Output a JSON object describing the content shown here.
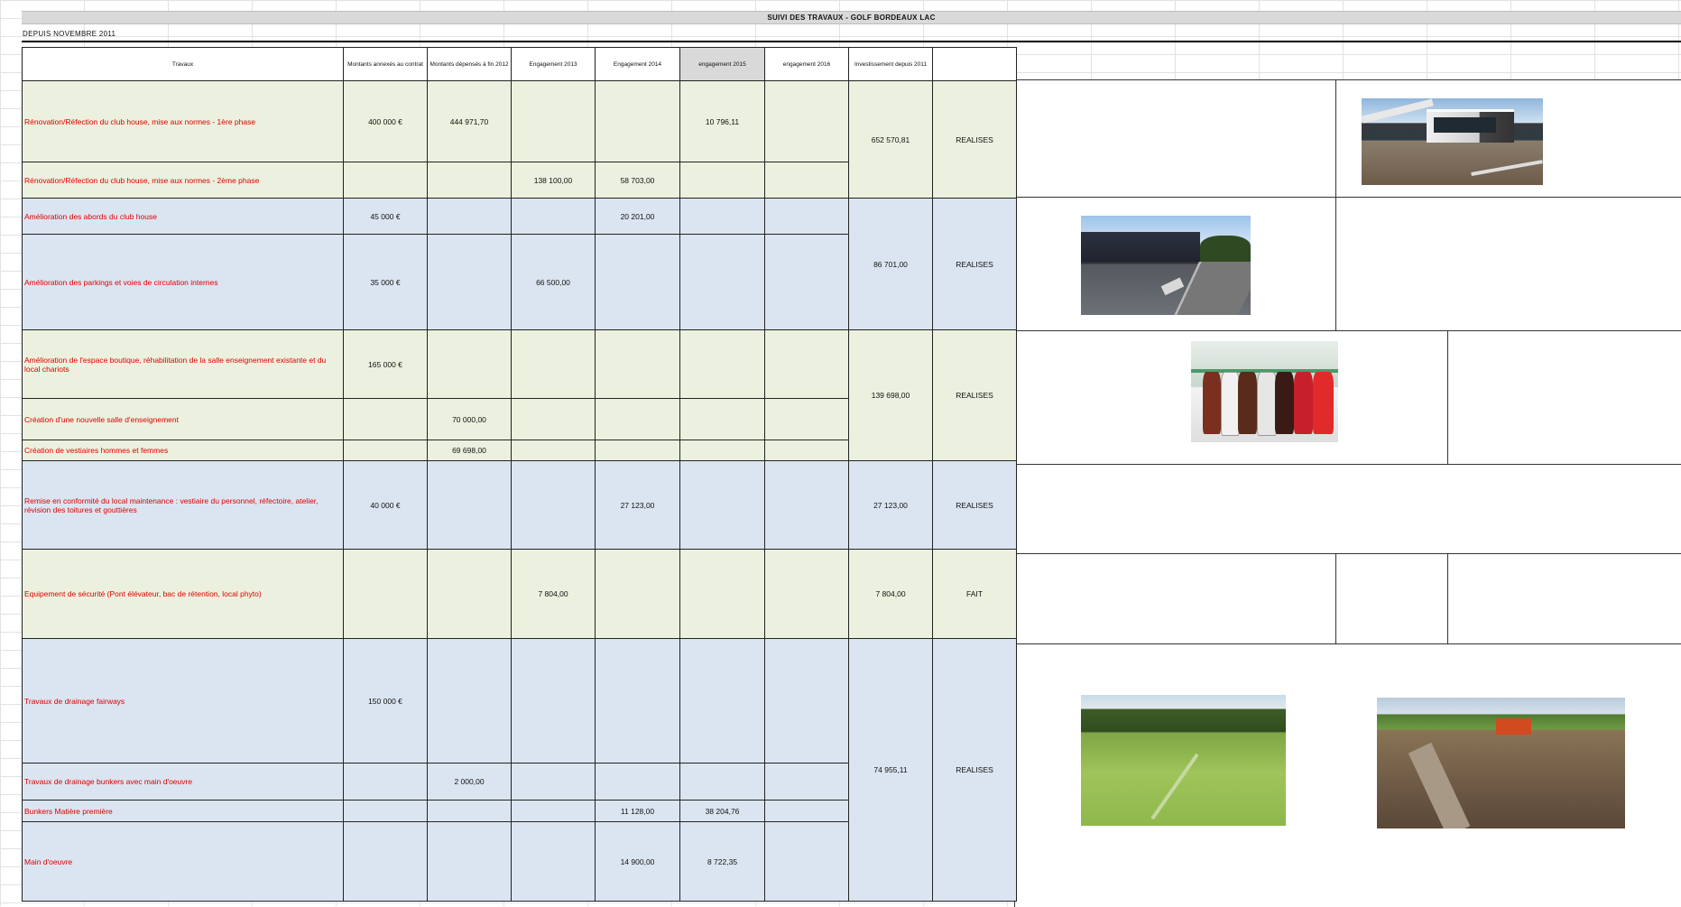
{
  "sheet": {
    "title": "SUIVI DES TRAVAUX - GOLF BORDEAUX LAC",
    "subtitle": "DEPUIS NOVEMBRE 2011"
  },
  "headers": {
    "travaux": "Travaux",
    "montants": "Montants annexés au contrat",
    "depenses": "Montants dépensés à fin 2012",
    "eng2013": "Engagement 2013",
    "eng2014": "Engagement 2014",
    "eng2015": "engagement 2015",
    "eng2016": "engagement 2016",
    "invest": "Investissement depuis 2011"
  },
  "groups": [
    {
      "color": "green",
      "investment": "652 570,81",
      "status": "REALISES",
      "rows": [
        {
          "label": "Rénovation/Réfection du club house, mise aux normes - 1ère phase",
          "montant": "400 000 €",
          "depenses": "444 971,70",
          "eng2013": "",
          "eng2014": "",
          "eng2015": "10 796,11",
          "eng2016": ""
        },
        {
          "label": "Rénovation/Réfection du club house, mise aux normes - 2ème phase",
          "montant": "",
          "depenses": "",
          "eng2013": "138 100,00",
          "eng2014": "58 703,00",
          "eng2015": "",
          "eng2016": ""
        }
      ]
    },
    {
      "color": "blue",
      "investment": "86 701,00",
      "status": "REALISES",
      "rows": [
        {
          "label": "Amélioration des abords du club house",
          "montant": "45 000 €",
          "depenses": "",
          "eng2013": "",
          "eng2014": "20 201,00",
          "eng2015": "",
          "eng2016": ""
        },
        {
          "label": "Amélioration des parkings et voies de circulation internes",
          "montant": "35 000 €",
          "depenses": "",
          "eng2013": "66 500,00",
          "eng2014": "",
          "eng2015": "",
          "eng2016": ""
        }
      ]
    },
    {
      "color": "green",
      "investment": "139 698,00",
      "status": "REALISES",
      "rows": [
        {
          "label": "Amélioration de l'espace boutique, réhabilitation de la salle enseignement existante et du local chariots",
          "montant": "165 000 €",
          "depenses": "",
          "eng2013": "",
          "eng2014": "",
          "eng2015": "",
          "eng2016": ""
        },
        {
          "label": "Création d'une nouvelle salle d'enseignement",
          "montant": "",
          "depenses": "70 000,00",
          "eng2013": "",
          "eng2014": "",
          "eng2015": "",
          "eng2016": ""
        },
        {
          "label": "Création de vestiaires hommes et femmes",
          "montant": "",
          "depenses": "69 698,00",
          "eng2013": "",
          "eng2014": "",
          "eng2015": "",
          "eng2016": ""
        }
      ]
    },
    {
      "color": "blue",
      "investment": "27 123,00",
      "status": "REALISES",
      "rows": [
        {
          "label": "Remise en conformité du local maintenance : vestiaire du personnel, réfectoire, atelier, révision des toitures et gouttières",
          "montant": "40 000 €",
          "depenses": "",
          "eng2013": "",
          "eng2014": "27 123,00",
          "eng2015": "",
          "eng2016": ""
        }
      ]
    },
    {
      "color": "green",
      "investment": "7 804,00",
      "status": "FAIT",
      "rows": [
        {
          "label": "Equipement de sécurité (Pont élévateur, bac de rétention, local phyto)",
          "montant": "",
          "depenses": "",
          "eng2013": "7 804,00",
          "eng2014": "",
          "eng2015": "",
          "eng2016": ""
        }
      ]
    },
    {
      "color": "blue",
      "investment": "74 955,11",
      "status": "REALISES",
      "rows": [
        {
          "label": "Travaux de drainage fairways",
          "montant": "150 000 €",
          "depenses": "",
          "eng2013": "",
          "eng2014": "",
          "eng2015": "",
          "eng2016": ""
        },
        {
          "label": "Travaux de drainage bunkers avec main d'oeuvre",
          "montant": "",
          "depenses": "2 000,00",
          "eng2013": "",
          "eng2014": "",
          "eng2015": "",
          "eng2016": ""
        },
        {
          "label": "Bunkers Matière première",
          "montant": "",
          "depenses": "",
          "eng2013": "",
          "eng2014": "11 128,00",
          "eng2015": "38 204,76",
          "eng2016": ""
        },
        {
          "label": "Main d'oeuvre",
          "montant": "",
          "depenses": "",
          "eng2013": "",
          "eng2014": "14 900,00",
          "eng2015": "8 722,35",
          "eng2016": ""
        }
      ]
    }
  ],
  "photos": [
    {
      "subject": "club house"
    },
    {
      "subject": "parking"
    },
    {
      "subject": "golf bags shop"
    },
    {
      "subject": "fairway drainage"
    },
    {
      "subject": "bunker drainage works"
    }
  ]
}
